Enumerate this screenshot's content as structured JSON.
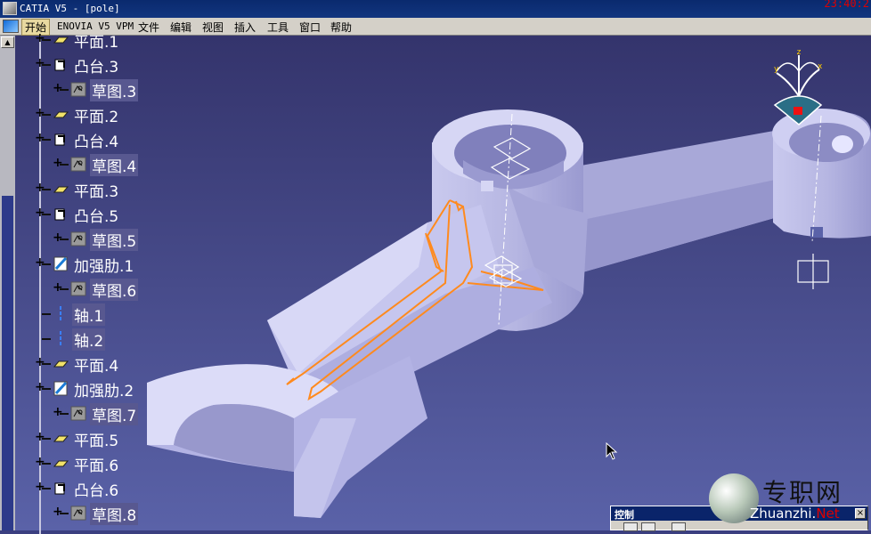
{
  "window": {
    "title": "CATIA V5 - [pole]",
    "clock": "23:40:2"
  },
  "menu": {
    "items": [
      {
        "label": "开始",
        "active": true
      },
      {
        "label": "ENOVIA V5 VPM"
      },
      {
        "label": "文件"
      },
      {
        "label": "编辑"
      },
      {
        "label": "视图"
      },
      {
        "label": "插入"
      },
      {
        "label": "工具"
      },
      {
        "label": "窗口"
      },
      {
        "label": "帮助"
      }
    ]
  },
  "tree": {
    "items": [
      {
        "label": "平面.1",
        "icon": "plane-icon",
        "level": 1,
        "expander": true
      },
      {
        "label": "凸台.3",
        "icon": "pad-icon",
        "level": 1,
        "expander": true
      },
      {
        "label": "草图.3",
        "icon": "sketch-icon",
        "level": 2,
        "expander": true
      },
      {
        "label": "平面.2",
        "icon": "plane-icon",
        "level": 1,
        "expander": true
      },
      {
        "label": "凸台.4",
        "icon": "pad-icon",
        "level": 1,
        "expander": true
      },
      {
        "label": "草图.4",
        "icon": "sketch-icon",
        "level": 2,
        "expander": true
      },
      {
        "label": "平面.3",
        "icon": "plane-icon",
        "level": 1,
        "expander": true
      },
      {
        "label": "凸台.5",
        "icon": "pad-icon",
        "level": 1,
        "expander": true
      },
      {
        "label": "草图.5",
        "icon": "sketch-icon",
        "level": 2,
        "expander": true
      },
      {
        "label": "加强肋.1",
        "icon": "rib-icon",
        "level": 1,
        "expander": true
      },
      {
        "label": "草图.6",
        "icon": "sketch-icon",
        "level": 2,
        "expander": true
      },
      {
        "label": "轴.1",
        "icon": "axis-icon",
        "level": 1,
        "expander": false
      },
      {
        "label": "轴.2",
        "icon": "axis-icon",
        "level": 1,
        "expander": false
      },
      {
        "label": "平面.4",
        "icon": "plane-icon",
        "level": 1,
        "expander": true
      },
      {
        "label": "加强肋.2",
        "icon": "rib-icon",
        "level": 1,
        "expander": true
      },
      {
        "label": "草图.7",
        "icon": "sketch-icon",
        "level": 2,
        "expander": true
      },
      {
        "label": "平面.5",
        "icon": "plane-icon",
        "level": 1,
        "expander": true
      },
      {
        "label": "平面.6",
        "icon": "plane-icon",
        "level": 1,
        "expander": true
      },
      {
        "label": "凸台.6",
        "icon": "pad-icon",
        "level": 1,
        "expander": true
      },
      {
        "label": "草图.8",
        "icon": "sketch-icon",
        "level": 2,
        "expander": true
      }
    ]
  },
  "viewport": {
    "compass_labels": {
      "z": "z",
      "y": "y",
      "x": "x"
    },
    "colors": {
      "background_top": "#34346c",
      "background_bottom": "#5a62a8",
      "part": "#b8b8e6",
      "highlight": "#ff8a1e"
    }
  },
  "control_panel": {
    "title": "控制"
  },
  "watermark": {
    "cn": "专职网",
    "en": "Zhuanzhi.",
    "net": "Net"
  }
}
